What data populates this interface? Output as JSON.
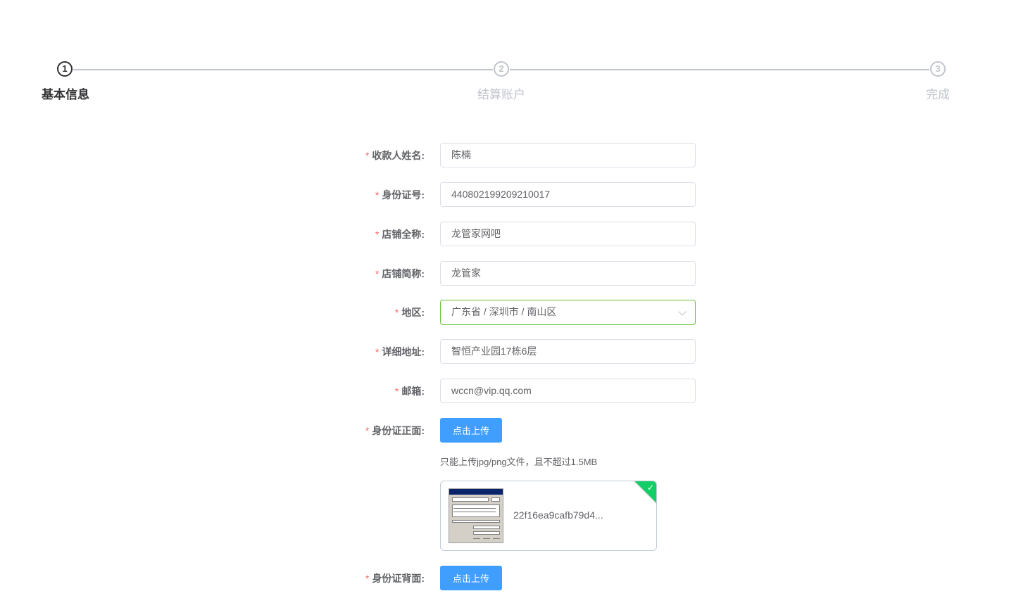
{
  "steps": [
    {
      "number": "1",
      "title": "基本信息",
      "status": "active"
    },
    {
      "number": "2",
      "title": "结算账户",
      "status": "wait"
    },
    {
      "number": "3",
      "title": "完成",
      "status": "wait"
    }
  ],
  "form": {
    "required_mark": "*",
    "payee_name": {
      "label": "收款人姓名:",
      "value": "陈楠"
    },
    "id_number": {
      "label": "身份证号:",
      "value": "440802199209210017"
    },
    "store_full_name": {
      "label": "店铺全称:",
      "value": "龙管家网吧"
    },
    "store_short_name": {
      "label": "店铺简称:",
      "value": "龙管家"
    },
    "region": {
      "label": "地区:",
      "value": "广东省 / 深圳市 / 南山区"
    },
    "address": {
      "label": "详细地址:",
      "value": "智恒产业园17栋6层"
    },
    "email": {
      "label": "邮箱:",
      "value": "wccn@vip.qq.com"
    },
    "id_front": {
      "label": "身份证正面:",
      "button": "点击上传",
      "tip": "只能上传jpg/png文件，且不超过1.5MB",
      "file_name": "22f16ea9cafb79d4..."
    },
    "id_back": {
      "label": "身份证背面:",
      "button": "点击上传"
    }
  },
  "colors": {
    "accent": "#409eff",
    "success": "#13ce66",
    "required": "#f56c6c"
  }
}
